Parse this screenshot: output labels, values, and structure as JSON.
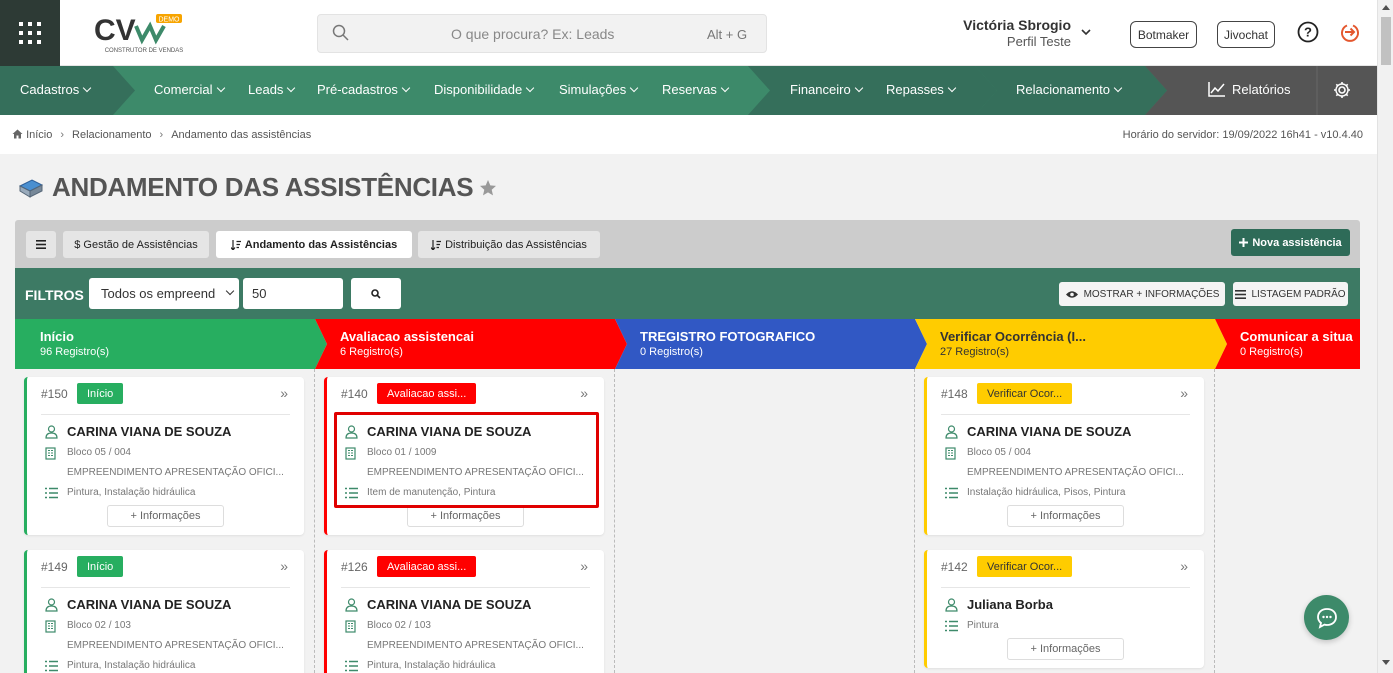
{
  "header": {
    "logo_text": "CV",
    "logo_badge": "DEMO",
    "logo_tagline": "CONSTRUTOR DE VENDAS",
    "search_placeholder": "O que procura? Ex: Leads",
    "search_shortcut": "Alt + G",
    "user_name": "Victória Sbrogio",
    "user_profile": "Perfil Teste",
    "botmaker": "Botmaker",
    "jivochat": "Jivochat"
  },
  "nav": {
    "items": [
      "Cadastros",
      "Comercial",
      "Leads",
      "Pré-cadastros",
      "Disponibilidade",
      "Simulações",
      "Reservas",
      "Financeiro",
      "Repasses",
      "Relacionamento"
    ],
    "reports": "Relatórios",
    "colors": {
      "base": "#3d8a6a",
      "dark": "#356f5b",
      "gray": "#555555"
    }
  },
  "breadcrumb": {
    "items": [
      "Início",
      "Relacionamento",
      "Andamento das assistências"
    ],
    "server_time": "Horário do servidor: 19/09/2022 16h41 - v10.4.40"
  },
  "page": {
    "title": "ANDAMENTO DAS ASSISTÊNCIAS"
  },
  "tabs": {
    "menu_icon": "hamburger-icon",
    "gestao": "$ Gestão de Assistências",
    "andamento": "Andamento das Assistências",
    "distribuicao": "Distribuição das Assistências",
    "nova": "Nova assistência"
  },
  "filters": {
    "label": "FILTROS",
    "empreendimento": "Todos os empreendimentos",
    "limit": "50",
    "mostrar": "MOSTRAR + INFORMAÇÕES",
    "listagem": "LISTAGEM PADRÃO"
  },
  "stages": [
    {
      "name": "Início",
      "count": "96 Registro(s)",
      "color": "#27ae60",
      "text": "#ffffff"
    },
    {
      "name": "Avaliacao assistencai",
      "count": "6 Registro(s)",
      "color": "#ff0000",
      "text": "#ffffff"
    },
    {
      "name": "TREGISTRO FOTOGRAFICO",
      "count": "0 Registro(s)",
      "color": "#3158c4",
      "text": "#ffffff"
    },
    {
      "name": "Verificar Ocorrência (I...",
      "count": "27 Registro(s)",
      "color": "#ffcc00",
      "text": "#333333"
    },
    {
      "name": "Comunicar a situa",
      "count": "0 Registro(s)",
      "color": "#ff0000",
      "text": "#ffffff"
    }
  ],
  "cards": [
    {
      "id": "#150",
      "badge": "Início",
      "name": "CARINA VIANA DE SOUZA",
      "unit": "Bloco 05 / 004",
      "emp": "EMPREENDIMENTO APRESENTAÇÃO OFICI...",
      "items": "Pintura, Instalação hidráulica",
      "more": "+ Informações"
    },
    {
      "id": "#149",
      "badge": "Início",
      "name": "CARINA VIANA DE SOUZA",
      "unit": "Bloco 02 / 103",
      "emp": "EMPREENDIMENTO APRESENTAÇÃO OFICI...",
      "items": "Pintura, Instalação hidráulica",
      "more": "+ Informações"
    },
    {
      "id": "#140",
      "badge": "Avaliacao assi...",
      "name": "CARINA VIANA DE SOUZA",
      "unit": "Bloco 01 / 1009",
      "emp": "EMPREENDIMENTO APRESENTAÇÃO OFICI...",
      "items": "Item de manutenção, Pintura",
      "more": "+ Informações"
    },
    {
      "id": "#126",
      "badge": "Avaliacao assi...",
      "name": "CARINA VIANA DE SOUZA",
      "unit": "Bloco 02 / 103",
      "emp": "EMPREENDIMENTO APRESENTAÇÃO OFICI...",
      "items": "Pintura, Instalação hidráulica",
      "more": "+ Informações"
    },
    {
      "id": "#148",
      "badge": "Verificar Ocor...",
      "name": "CARINA VIANA DE SOUZA",
      "unit": "Bloco 05 / 004",
      "emp": "EMPREENDIMENTO APRESENTAÇÃO OFICI...",
      "items": "Instalação hidráulica, Pisos, Pintura",
      "more": "+ Informações"
    },
    {
      "id": "#142",
      "badge": "Verificar Ocor...",
      "name": "Juliana Borba",
      "items": "Pintura",
      "more": "+ Informações"
    }
  ]
}
